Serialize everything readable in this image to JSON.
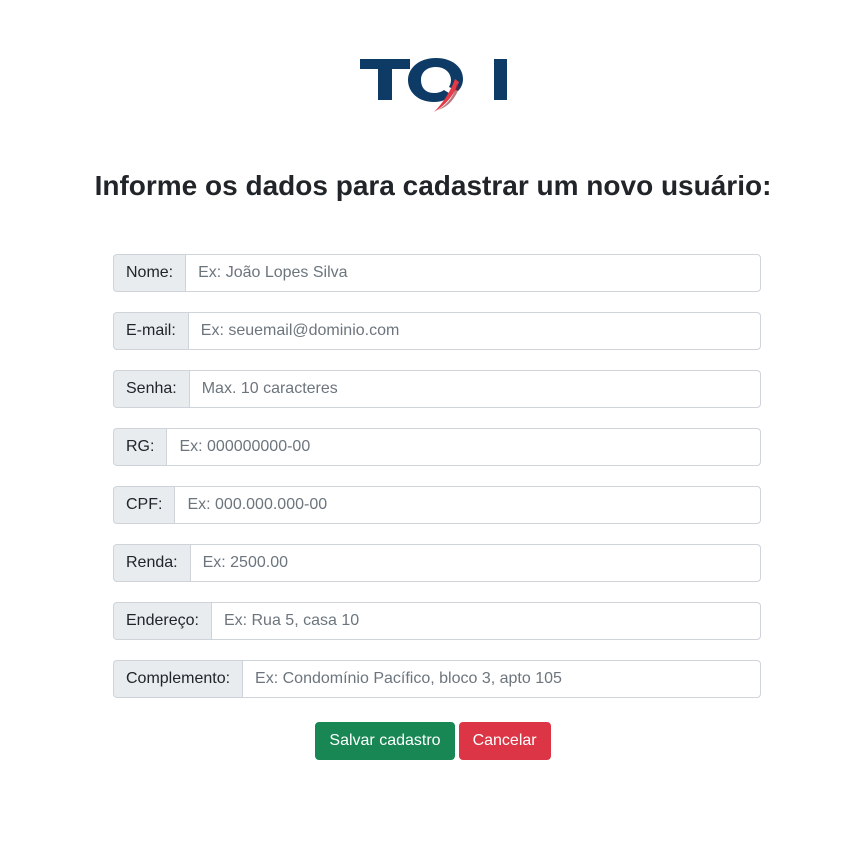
{
  "header": {
    "logo_text": "TQI",
    "title": "Informe os dados para cadastrar um novo usuário:"
  },
  "form": {
    "fields": [
      {
        "label": "Nome:",
        "placeholder": "Ex: João Lopes Silva",
        "value": ""
      },
      {
        "label": "E-mail:",
        "placeholder": "Ex: seuemail@dominio.com",
        "value": ""
      },
      {
        "label": "Senha:",
        "placeholder": "Max. 10 caracteres",
        "value": ""
      },
      {
        "label": "RG:",
        "placeholder": "Ex: 000000000-00",
        "value": ""
      },
      {
        "label": "CPF:",
        "placeholder": "Ex: 000.000.000-00",
        "value": ""
      },
      {
        "label": "Renda:",
        "placeholder": "Ex: 2500.00",
        "value": ""
      },
      {
        "label": "Endereço:",
        "placeholder": "Ex: Rua 5, casa 10",
        "value": ""
      },
      {
        "label": "Complemento:",
        "placeholder": "Ex: Condomínio Pacífico, bloco 3, apto 105",
        "value": ""
      }
    ]
  },
  "actions": {
    "save_label": "Salvar cadastro",
    "cancel_label": "Cancelar"
  },
  "colors": {
    "logo_navy": "#0d3b66",
    "logo_red": "#e63946",
    "save": "#198754",
    "cancel": "#dc3545",
    "addon_bg": "#e9ecef",
    "border": "#ced4da"
  }
}
